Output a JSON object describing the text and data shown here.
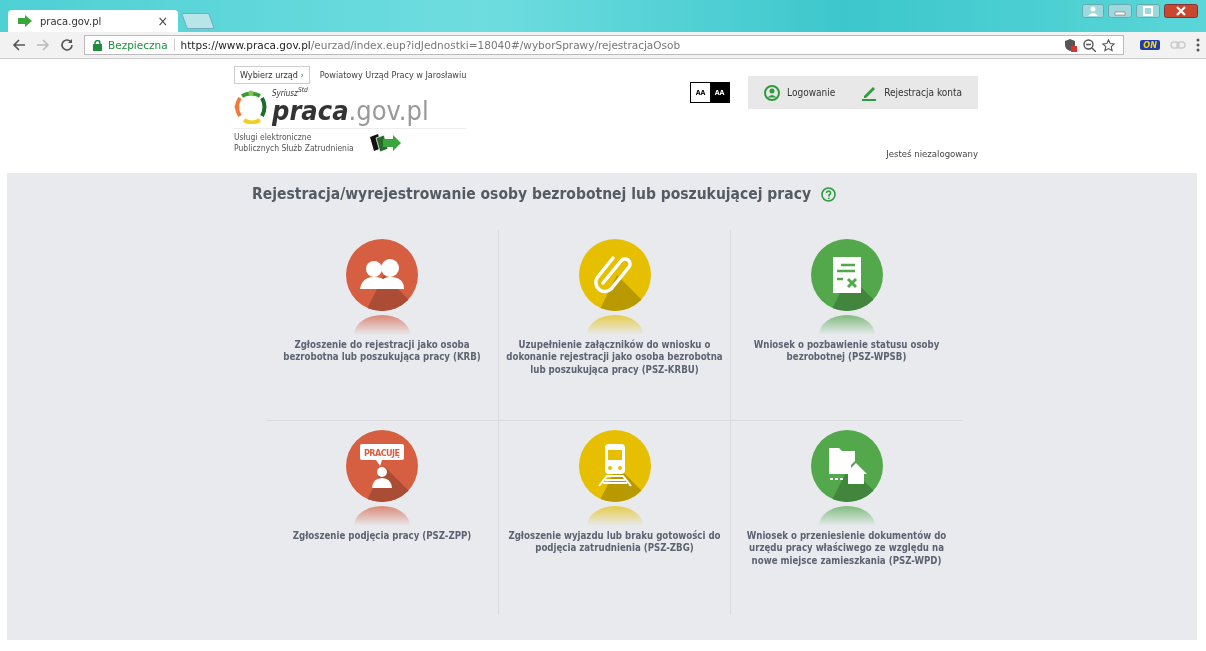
{
  "browser": {
    "tab": {
      "title": "praca.gov.pl",
      "close": "×"
    },
    "address": {
      "secure_label": "Bezpieczna",
      "url_host": "https://www.praca.gov.pl",
      "url_path": "/eurzad/index.eup?idJednostki=18040#/wyborSprawy/rejestracjaOsob"
    },
    "extension_badge": "ON"
  },
  "header": {
    "office_button": "Wybierz urząd",
    "office_button_arrow": "›",
    "office_name": "Powiatowy Urząd Pracy w Jarosławiu",
    "logo": {
      "superscript": "Syriusz",
      "superscript_tag": "Std",
      "main": "praca",
      "domain": ".gov.pl"
    },
    "services_caption": [
      "Usługi elektroniczne",
      "Publicznych Służb Zatrudnienia"
    ],
    "contrast": [
      {
        "kind": "light",
        "label": "AA"
      },
      {
        "kind": "dark",
        "label": "AA"
      }
    ],
    "actions": [
      {
        "kind": "login",
        "label": "Logowanie"
      },
      {
        "kind": "register",
        "label": "Rejestracja konta"
      }
    ],
    "user_status": "Jesteś niezalogowany"
  },
  "page": {
    "title": "Rejestracja/wyrejestrowanie osoby bezrobotnej lub poszukującej pracy",
    "tiles": [
      {
        "kind": "people",
        "color": "#d65f41",
        "label": "Zgłoszenie do rejestracji jako osoba bezrobotna lub poszukująca pracy (KRB)"
      },
      {
        "kind": "paperclip",
        "color": "#e6bf00",
        "label": "Uzupełnienie załączników do wniosku o dokonanie rejestracji jako osoba bezrobotna lub poszukująca pracy (PSZ-KRBU)"
      },
      {
        "kind": "document",
        "color": "#53a84c",
        "label": "Wniosek o pozbawienie statusu osoby bezrobotnej (PSZ-WPSB)"
      },
      {
        "kind": "speech",
        "color": "#d65f41",
        "label": "Zgłoszenie podjęcia pracy (PSZ-ZPP)",
        "icon_text": "PRACUJĘ"
      },
      {
        "kind": "train",
        "color": "#e6bf00",
        "label": "Zgłoszenie wyjazdu lub braku gotowości do podjęcia zatrudnienia (PSZ-ZBG)"
      },
      {
        "kind": "folder",
        "color": "#53a84c",
        "label": "Wniosek o przeniesienie dokumentów do urzędu pracy właściwego ze względu na nowe miejsce zamieszkania (PSZ-WPD)"
      }
    ]
  }
}
